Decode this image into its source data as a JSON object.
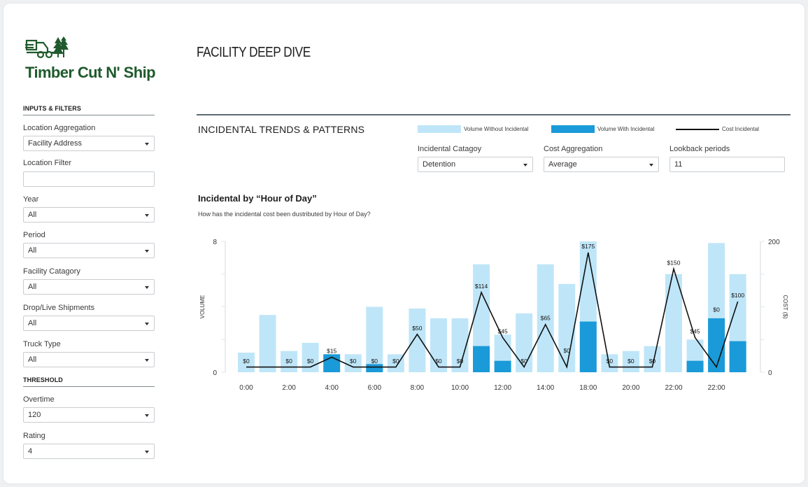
{
  "brand": {
    "name": "Timber Cut N' Ship",
    "color": "#1f5a2c",
    "logo_icon": "truck-with-trees-icon"
  },
  "page": {
    "title": "FACILITY DEEP DIVE"
  },
  "sidebar": {
    "inputs_header": "INPUTS & FILTERS",
    "threshold_header": "THRESHOLD",
    "filters": {
      "location_aggregation": {
        "label": "Location Aggregation",
        "value": "Facility Address"
      },
      "location_filter": {
        "label": "Location Filter",
        "value": ""
      },
      "year": {
        "label": "Year",
        "value": "All"
      },
      "period": {
        "label": "Period",
        "value": "All"
      },
      "facility_category": {
        "label": "Facility Catagory",
        "value": "All"
      },
      "drop_live": {
        "label": "Drop/Live Shipments",
        "value": "All"
      },
      "truck_type": {
        "label": "Truck Type",
        "value": "All"
      }
    },
    "thresholds": {
      "overtime": {
        "label": "Overtime",
        "value": "120"
      },
      "rating": {
        "label": "Rating",
        "value": "4"
      }
    }
  },
  "main": {
    "section_title": "INCIDENTAL TRENDS & PATTERNS",
    "legend": {
      "without": "Volume Without Incidental",
      "with": "Volume With Incidental",
      "cost": "Cost Incidental"
    },
    "controls": {
      "incidental_category": {
        "label": "Incidental Catagoy",
        "value": "Detention"
      },
      "cost_aggregation": {
        "label": "Cost Aggregation",
        "value": "Average"
      },
      "lookback": {
        "label": "Lookback periods",
        "value": "11"
      }
    },
    "chart_heading": "Incidental by “Hour of Day”",
    "chart_subtitle": "How has the incidental cost been dustributed by Hour of Day?"
  },
  "colors": {
    "light_bar": "#bfe6f8",
    "dark_bar": "#1a9ad8",
    "line": "#111111"
  },
  "chart_data": {
    "type": "bar",
    "ylabel": "VOLUME",
    "y2label": "COST ($)",
    "ylim": [
      0,
      8
    ],
    "y2lim": [
      0,
      200
    ],
    "y_ticks": [
      "0",
      "8"
    ],
    "y2_ticks": [
      "0",
      "200"
    ],
    "x_tick_labels": [
      "0:00",
      "2:00",
      "4:00",
      "6:00",
      "8:00",
      "10:00",
      "12:00",
      "14:00",
      "18:00",
      "20:00",
      "22:00",
      "22:00"
    ],
    "categories": [
      "0",
      "1",
      "2",
      "3",
      "4",
      "5",
      "6",
      "7",
      "8",
      "9",
      "10",
      "11",
      "12",
      "13",
      "14",
      "15",
      "16",
      "17",
      "18",
      "19",
      "20",
      "21",
      "22",
      "23"
    ],
    "series": [
      {
        "name": "Volume Without Incidental",
        "values": [
          1.2,
          3.5,
          1.3,
          1.8,
          0,
          1.1,
          4.0,
          1.1,
          3.9,
          3.3,
          3.3,
          6.6,
          2.3,
          3.6,
          6.6,
          5.4,
          8.0,
          1.1,
          1.3,
          1.6,
          6.0,
          2.0,
          7.9,
          6.0
        ]
      },
      {
        "name": "Volume With Incidental",
        "values": [
          0,
          0,
          0,
          0,
          1.1,
          0,
          0.5,
          0,
          0,
          0,
          0,
          1.6,
          0.7,
          0,
          0,
          0,
          3.1,
          0,
          0,
          0,
          0,
          0.7,
          3.3,
          1.9
        ]
      },
      {
        "name": "Cost Incidental",
        "values": [
          0,
          0,
          0,
          0,
          15,
          0,
          0,
          0,
          50,
          0,
          0,
          114,
          45,
          0,
          65,
          0,
          175,
          0,
          0,
          0,
          150,
          45,
          0,
          100
        ]
      }
    ],
    "data_labels": [
      "$0",
      "",
      "$0",
      "$0",
      "$15",
      "$0",
      "$0",
      "$0",
      "$50",
      "$0",
      "$0",
      "$114",
      "$45",
      "$0",
      "$65",
      "$0",
      "$175",
      "$0",
      "$0",
      "$0",
      "$150",
      "$45",
      "$0",
      "$100"
    ],
    "grid": false
  }
}
